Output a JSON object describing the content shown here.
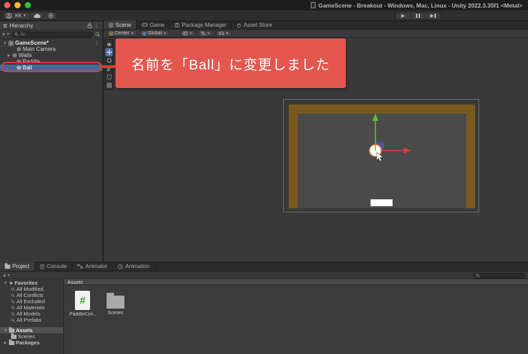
{
  "window": {
    "title": "GameScene - Breakout - Windows, Mac, Linux - Unity 2022.3.35f1 <Metal>"
  },
  "toolbar": {
    "account_initials": "KK"
  },
  "hierarchy": {
    "title": "Hierarchy",
    "search_placeholder": "All",
    "scene_row": "GameScene*",
    "items": [
      {
        "label": "Main Camera"
      },
      {
        "label": "Walls"
      },
      {
        "label": "Paddle"
      },
      {
        "label": "Ball",
        "selected": true
      }
    ]
  },
  "scene_tabs": [
    {
      "label": "Scene"
    },
    {
      "label": "Game"
    },
    {
      "label": "Package Manager"
    },
    {
      "label": "Asset Store"
    }
  ],
  "scene_toolbar": {
    "pivot": "Center",
    "orientation": "Global"
  },
  "annotation": {
    "message": "名前を「Ball」に変更しました"
  },
  "bottom_tabs": [
    {
      "label": "Project"
    },
    {
      "label": "Console"
    },
    {
      "label": "Animator"
    },
    {
      "label": "Animation"
    }
  ],
  "project": {
    "favorites_title": "Favorites",
    "favorites": [
      {
        "label": "All Modified"
      },
      {
        "label": "All Conflicts"
      },
      {
        "label": "All Excluded"
      },
      {
        "label": "All Materials"
      },
      {
        "label": "All Models"
      },
      {
        "label": "All Prefabs"
      }
    ],
    "assets_folder": "Assets",
    "scenes_folder": "Scenes",
    "packages_folder": "Packages",
    "breadcrumb": "Assets",
    "items": [
      {
        "label": "PaddleCon...",
        "type": "csharp-script"
      },
      {
        "label": "Scenes",
        "type": "folder"
      }
    ]
  },
  "icons": {
    "play": "triangle-right",
    "pause": "double-bar",
    "step": "triangle-bar",
    "search": "magnifier-circle",
    "lock": "open-padlock",
    "cloud": "cloud-shape",
    "person": "head-circle",
    "folder": "tabbed-rectangle",
    "star": "★",
    "gameobject": "cube-outline",
    "move-gizmo": "axis-arrows"
  },
  "colors": {
    "selection_blue": "#4a6896",
    "annotation_red": "#e4574f",
    "annotation_stroke": "#e23a31",
    "wall_brown": "#7a5a1f",
    "play_area_grey": "#4a4a4a",
    "script_green": "#3f9e3f",
    "gizmo_green": "#5cc431",
    "gizmo_red": "#e03e3e",
    "gizmo_blue": "#4d65d2"
  }
}
